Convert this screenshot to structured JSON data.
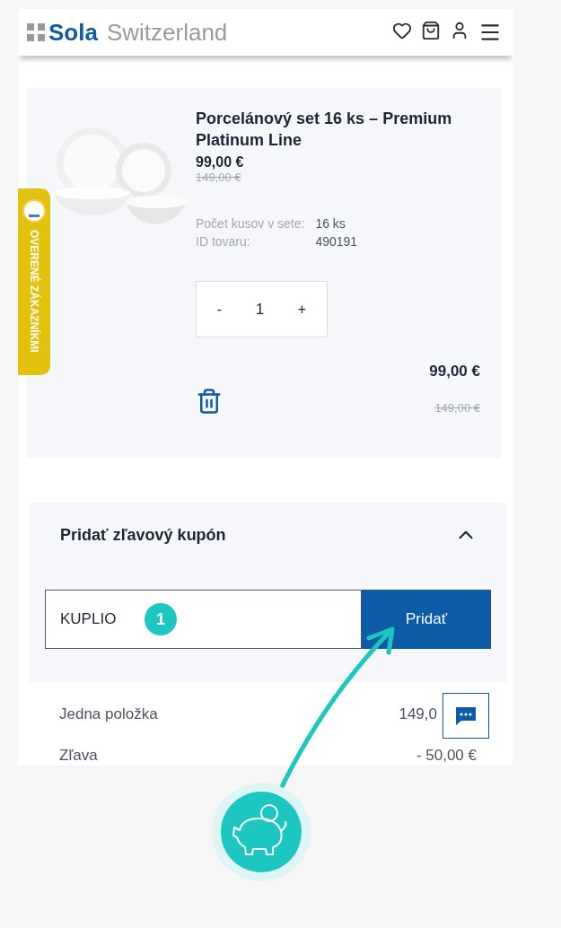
{
  "header": {
    "logo": {
      "brand": "Sola",
      "subtitle": "Switzerland"
    }
  },
  "side_badge": {
    "text": "OVERENÉ ZÁKAZNÍKMI"
  },
  "product": {
    "title": "Porcelánový set 16 ks – Premium Platinum Line",
    "price": "99,00 €",
    "old_price": "149,00 €",
    "specs": [
      {
        "label": "Počet kusov v sete:",
        "value": "16 ks"
      },
      {
        "label": "ID tovaru:",
        "value": "490191"
      }
    ],
    "quantity": {
      "minus": "-",
      "value": "1",
      "plus": "+"
    },
    "total": "99,00 €",
    "total_old": "149,00 €"
  },
  "coupon": {
    "title": "Pridať zľavový kupón",
    "expanded": true,
    "value": "KUPLIO",
    "step_badge": "1",
    "button": "Pridať"
  },
  "summary": [
    {
      "label": "Jedna položka",
      "value": "149,0"
    },
    {
      "label": "Zľava",
      "value": "- 50,00 €"
    }
  ]
}
